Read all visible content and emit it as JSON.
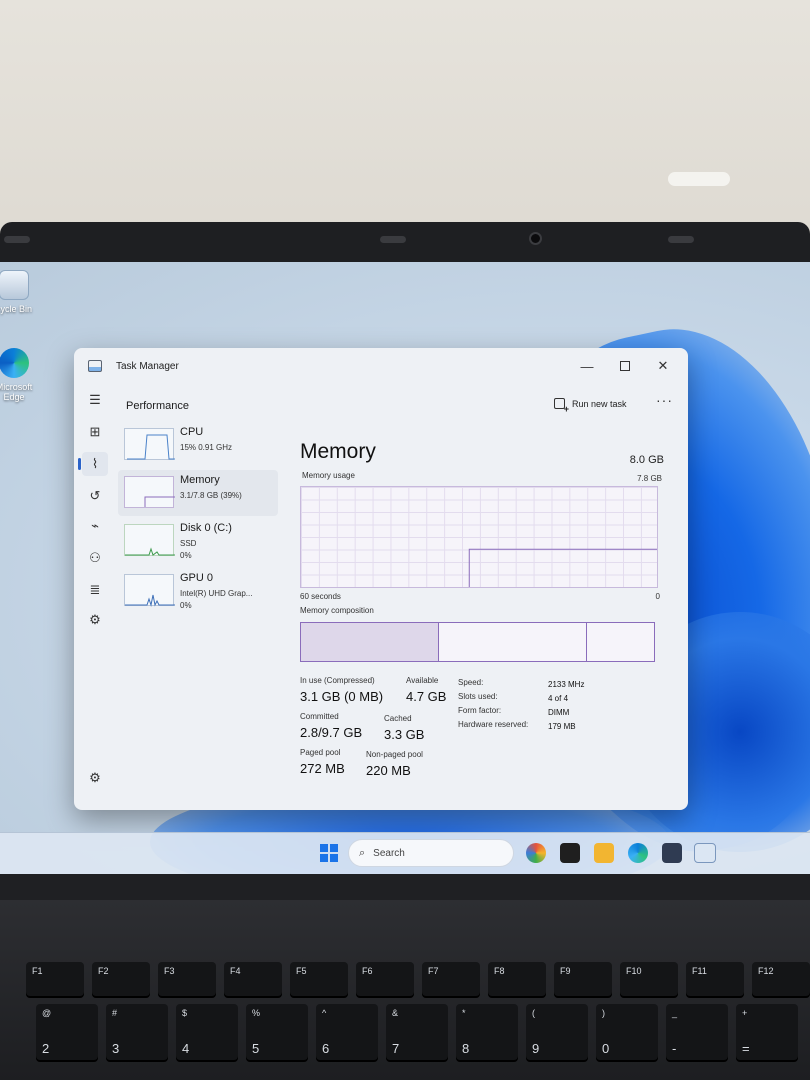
{
  "desktop": {
    "recycle_bin_label": "cycle Bin",
    "edge_label_line1": "Microsoft",
    "edge_label_line2": "Edge"
  },
  "window": {
    "title": "Task Manager",
    "page_title": "Performance",
    "run_new_task": "Run new task",
    "more": "···"
  },
  "sidebar": {
    "items": [
      {
        "name": "CPU",
        "sub1": "15% 0.91 GHz",
        "sub2": ""
      },
      {
        "name": "Memory",
        "sub1": "3.1/7.8 GB (39%)",
        "sub2": ""
      },
      {
        "name": "Disk 0 (C:)",
        "sub1": "SSD",
        "sub2": "0%"
      },
      {
        "name": "GPU 0",
        "sub1": "Intel(R) UHD Grap...",
        "sub2": "0%"
      }
    ]
  },
  "memory": {
    "title": "Memory",
    "total": "8.0 GB",
    "usage_label": "Memory usage",
    "usage_max": "7.8 GB",
    "time_label": "60 seconds",
    "zero_label": "0",
    "composition_label": "Memory composition",
    "in_use_label": "In use (Compressed)",
    "in_use_value": "3.1 GB (0 MB)",
    "available_label": "Available",
    "available_value": "4.7 GB",
    "committed_label": "Committed",
    "committed_value": "2.8/9.7 GB",
    "cached_label": "Cached",
    "cached_value": "3.3 GB",
    "paged_label": "Paged pool",
    "paged_value": "272 MB",
    "nonpaged_label": "Non-paged pool",
    "nonpaged_value": "220 MB",
    "speed_label": "Speed:",
    "speed_value": "2133 MHz",
    "slots_label": "Slots used:",
    "slots_value": "4 of 4",
    "form_label": "Form factor:",
    "form_value": "DIMM",
    "hw_label": "Hardware reserved:",
    "hw_value": "179 MB",
    "usage_fraction": 0.39,
    "composition_fractions": {
      "in_use": 0.39,
      "modified": 0.0,
      "standby": 0.42,
      "free": 0.19
    }
  },
  "taskbar": {
    "search": "Search"
  },
  "keyboard": {
    "fkeys": [
      "F1",
      "F2",
      "F3",
      "F4",
      "F5",
      "F6",
      "F7",
      "F8",
      "F9",
      "F10",
      "F11",
      "F12"
    ],
    "numrow": [
      {
        "top": "@",
        "bottom": "2"
      },
      {
        "top": "#",
        "bottom": "3"
      },
      {
        "top": "$",
        "bottom": "4"
      },
      {
        "top": "%",
        "bottom": "5"
      },
      {
        "top": "^",
        "bottom": "6"
      },
      {
        "top": "&",
        "bottom": "7"
      },
      {
        "top": "*",
        "bottom": "8"
      },
      {
        "top": "(",
        "bottom": "9"
      },
      {
        "top": ")",
        "bottom": "0"
      },
      {
        "top": "_",
        "bottom": "-"
      },
      {
        "top": "+",
        "bottom": "="
      }
    ]
  }
}
